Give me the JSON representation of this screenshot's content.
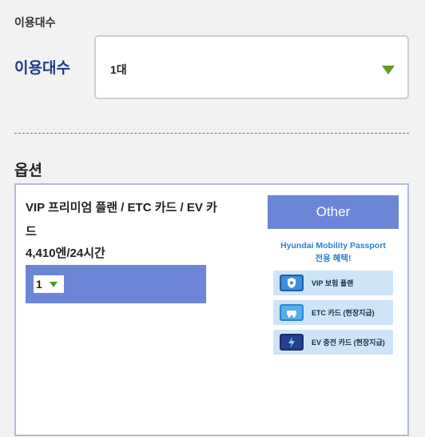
{
  "count_section": {
    "heading": "이용대수",
    "label": "이용대수",
    "selected_value": "1대"
  },
  "options_section": {
    "title": "옵션",
    "option": {
      "name": "VIP 프리미엄 플랜 / ETC 카드 / EV 카드",
      "price": "4,410엔/24시간",
      "quantity": "1"
    },
    "other_button_label": "Other",
    "promo_title": "Hyundai Mobility Passport\n전용 혜택!",
    "promo_items": [
      {
        "label": "VIP 보험 플랜",
        "icon": "shield-card-icon"
      },
      {
        "label": "ETC 카드 (현장지급)",
        "icon": "car-card-icon"
      },
      {
        "label": "EV 충전 카드 (현장지급)",
        "icon": "ev-charge-card-icon"
      }
    ]
  },
  "colors": {
    "accent_blue": "#6b86d6",
    "label_navy": "#1f3a8a",
    "dropdown_green": "#5e9c22",
    "promo_text_blue": "#2a7fd6"
  }
}
